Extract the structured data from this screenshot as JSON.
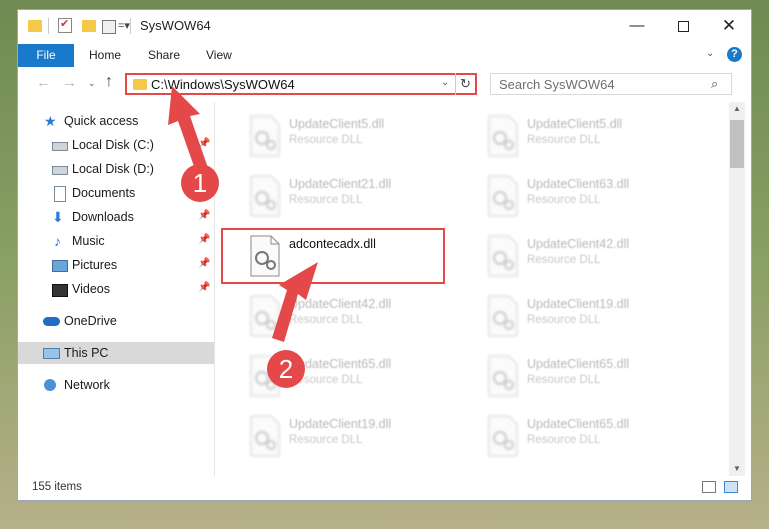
{
  "window": {
    "title": "SysWOW64",
    "qa_customize": "=▾",
    "minimize_glyph": "—",
    "close_glyph": "✕"
  },
  "ribbon": {
    "tabs": [
      "File",
      "Home",
      "Share",
      "View"
    ],
    "collapse_glyph": "⌄",
    "help_glyph": "?"
  },
  "address": {
    "path": "C:\\Windows\\SysWOW64",
    "back_glyph": "←",
    "forward_glyph": "→",
    "recent_glyph": "⌄",
    "up_glyph": "↑",
    "dropdown_glyph": "⌄",
    "refresh_glyph": "↻"
  },
  "search": {
    "placeholder": "Search SysWOW64",
    "icon_glyph": "⌕"
  },
  "nav": {
    "pin_glyph": "📌",
    "items": [
      {
        "label": "Quick access",
        "icon": "star-icon",
        "pinned": false
      },
      {
        "label": "Local Disk (C:)",
        "icon": "drive-icon",
        "pinned": true
      },
      {
        "label": "Local Disk (D:)",
        "icon": "drive-icon",
        "pinned": false
      },
      {
        "label": "Documents",
        "icon": "document-icon",
        "pinned": true
      },
      {
        "label": "Downloads",
        "icon": "download-icon",
        "pinned": true
      },
      {
        "label": "Music",
        "icon": "music-icon",
        "pinned": true
      },
      {
        "label": "Pictures",
        "icon": "picture-icon",
        "pinned": true
      },
      {
        "label": "Videos",
        "icon": "video-icon",
        "pinned": true
      },
      {
        "label": "OneDrive",
        "icon": "cloud-icon",
        "pinned": false
      },
      {
        "label": "This PC",
        "icon": "computer-icon",
        "pinned": false,
        "selected": true
      },
      {
        "label": "Network",
        "icon": "network-icon",
        "pinned": false
      }
    ]
  },
  "files": [
    {
      "name": "UpdateClient5.dll",
      "type": "Resource DLL"
    },
    {
      "name": "UpdateClient5.dll",
      "type": "Resource DLL"
    },
    {
      "name": "UpdateClient21.dll",
      "type": "Resource DLL"
    },
    {
      "name": "UpdateClient63.dll",
      "type": "Resource DLL"
    },
    {
      "name": "adcontecadx.dll",
      "type": "",
      "highlighted": true
    },
    {
      "name": "UpdateClient42.dll",
      "type": "Resource DLL"
    },
    {
      "name": "UpdateClient42.dll",
      "type": "Resource DLL"
    },
    {
      "name": "UpdateClient19.dll",
      "type": "Resource DLL"
    },
    {
      "name": "UpdateClient65.dll",
      "type": "Resource DLL"
    },
    {
      "name": "UpdateClient65.dll",
      "type": "Resource DLL"
    },
    {
      "name": "UpdateClient19.dll",
      "type": "Resource DLL"
    },
    {
      "name": "UpdateClient65.dll",
      "type": "Resource DLL"
    }
  ],
  "scrollbar": {
    "up_glyph": "▲",
    "down_glyph": "▼"
  },
  "status": {
    "item_count": "155 items"
  },
  "annotations": {
    "step1": "1",
    "step2": "2",
    "color": "#e44848"
  }
}
